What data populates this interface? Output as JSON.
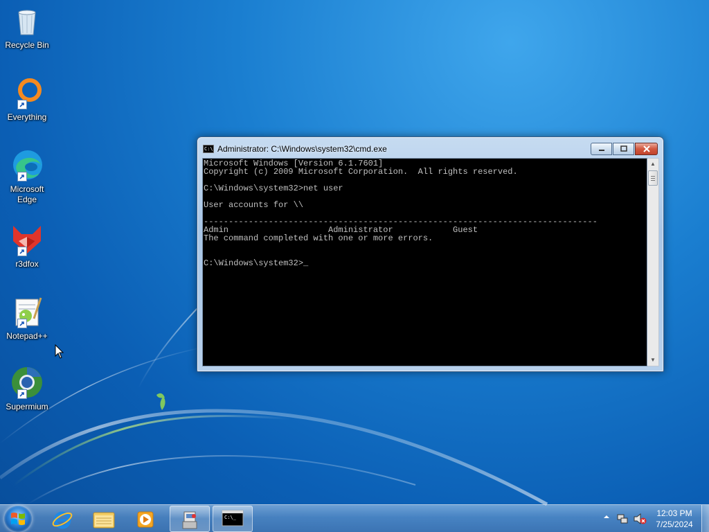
{
  "desktop": {
    "icons": [
      {
        "label": "Recycle Bin",
        "icon": "recycle-bin-icon"
      },
      {
        "label": "Everything",
        "icon": "everything-search-icon"
      },
      {
        "label": "Microsoft Edge",
        "icon": "edge-icon"
      },
      {
        "label": "r3dfox",
        "icon": "r3dfox-icon"
      },
      {
        "label": "Notepad++",
        "icon": "notepadpp-icon"
      },
      {
        "label": "Supermium",
        "icon": "supermium-icon"
      }
    ]
  },
  "cmd": {
    "title": "Administrator: C:\\Windows\\system32\\cmd.exe",
    "app_icon_text": "C:\\",
    "lines": [
      "Microsoft Windows [Version 6.1.7601]",
      "Copyright (c) 2009 Microsoft Corporation.  All rights reserved.",
      "",
      "C:\\Windows\\system32>net user",
      "",
      "User accounts for \\\\",
      "",
      "-------------------------------------------------------------------------------",
      "Admin                    Administrator            Guest",
      "The command completed with one or more errors.",
      "",
      "",
      "C:\\Windows\\system32>"
    ],
    "cursor": "_"
  },
  "taskbar": {
    "pinned": [
      {
        "name": "start-button"
      },
      {
        "name": "internet-explorer"
      },
      {
        "name": "windows-explorer"
      },
      {
        "name": "media-player"
      },
      {
        "name": "control-panel"
      },
      {
        "name": "cmd"
      }
    ],
    "tray_icons": [
      "show-hidden-icons",
      "network-icon",
      "volume-muted-icon"
    ],
    "clock": {
      "time": "12:03 PM",
      "date": "7/25/2024"
    }
  },
  "colors": {
    "desktop_bg": "#1a7ed0",
    "console_bg": "#000000",
    "console_fg": "#c0c0c0",
    "close_button": "#c0432c"
  }
}
